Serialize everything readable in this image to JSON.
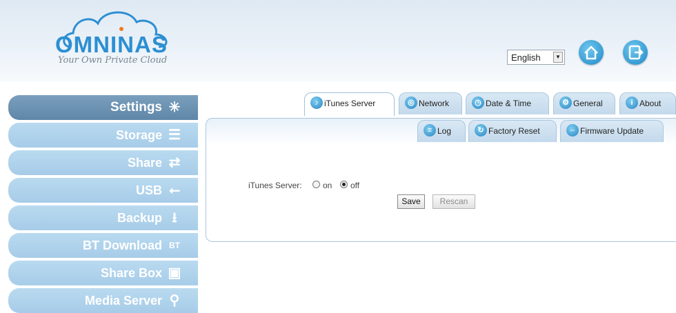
{
  "header": {
    "brand": "OMNINAS",
    "tagline": "Your Own Private Cloud",
    "language": "English",
    "home_icon": "home-icon",
    "logout_icon": "logout-icon"
  },
  "sidebar": {
    "items": [
      {
        "label": "Settings",
        "icon": "settings-icon",
        "active": true
      },
      {
        "label": "Storage",
        "icon": "storage-icon"
      },
      {
        "label": "Share",
        "icon": "share-icon"
      },
      {
        "label": "USB",
        "icon": "usb-icon"
      },
      {
        "label": "Backup",
        "icon": "backup-icon"
      },
      {
        "label": "BT Download",
        "icon": "bt-download-icon"
      },
      {
        "label": "Share Box",
        "icon": "share-box-icon"
      },
      {
        "label": "Media Server",
        "icon": "media-server-icon"
      }
    ]
  },
  "tabs": {
    "row1": [
      "iTunes Server",
      "Network",
      "Date & Time",
      "General",
      "About"
    ],
    "row2": [
      "Log",
      "Factory Reset",
      "Firmware Update"
    ],
    "active": "iTunes Server"
  },
  "form": {
    "label": "iTunes Server:",
    "option_on": "on",
    "option_off": "off",
    "selected": "off",
    "save": "Save",
    "rescan": "Rescan"
  },
  "colors": {
    "accent": "#2c8fd2",
    "sidebar_active": "#6d93b3",
    "sidebar": "#b0d3ec"
  }
}
